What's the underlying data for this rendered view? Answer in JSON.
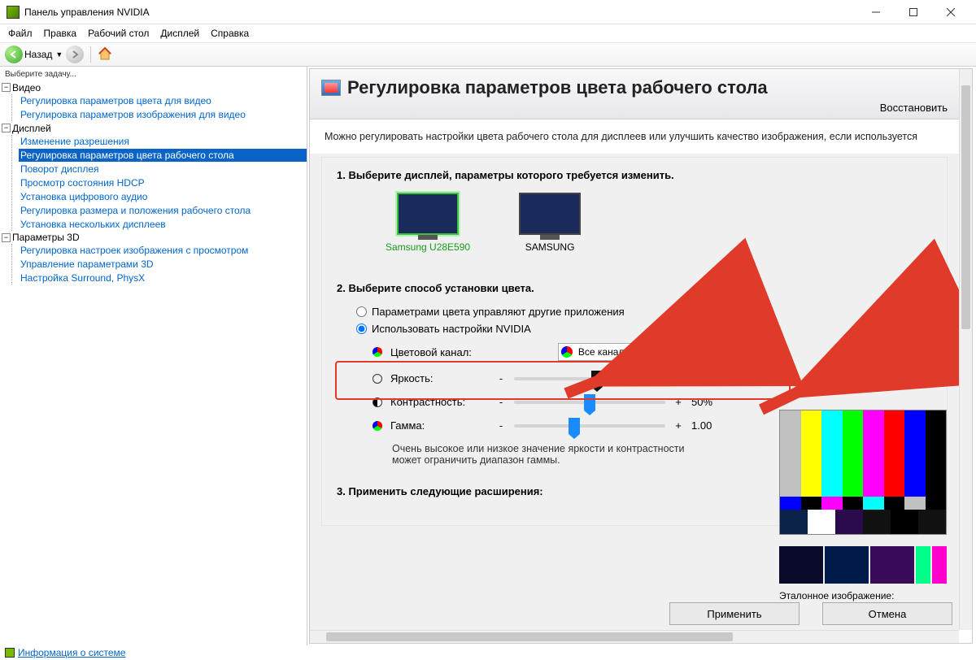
{
  "window": {
    "title": "Панель управления NVIDIA"
  },
  "menu": {
    "file": "Файл",
    "edit": "Правка",
    "desktop": "Рабочий стол",
    "display": "Дисплей",
    "help": "Справка"
  },
  "toolbar": {
    "back": "Назад"
  },
  "sidebar": {
    "task_label": "Выберите задачу...",
    "groups": [
      {
        "label": "Видео",
        "items": [
          "Регулировка параметров цвета для видео",
          "Регулировка параметров изображения для видео"
        ]
      },
      {
        "label": "Дисплей",
        "items": [
          "Изменение разрешения",
          "Регулировка параметров цвета рабочего стола",
          "Поворот дисплея",
          "Просмотр состояния HDCP",
          "Установка цифрового аудио",
          "Регулировка размера и положения рабочего стола",
          "Установка нескольких дисплеев"
        ],
        "selected": 1
      },
      {
        "label": "Параметры 3D",
        "items": [
          "Регулировка настроек изображения с просмотром",
          "Управление параметрами 3D",
          "Настройка Surround, PhysX"
        ]
      }
    ]
  },
  "page": {
    "title": "Регулировка параметров цвета рабочего стола",
    "restore": "Восстановить",
    "intro": "Можно регулировать настройки цвета рабочего стола для дисплеев или улучшить качество изображения, если используется",
    "step1_title": "1. Выберите дисплей, параметры которого требуется изменить.",
    "displays": [
      {
        "name": "Samsung U28E590",
        "active": true
      },
      {
        "name": "SAMSUNG",
        "active": false
      }
    ],
    "step2_title": "2. Выберите способ установки цвета.",
    "radio_other": "Параметрами цвета управляют другие приложения",
    "radio_nvidia": "Использовать настройки NVIDIA",
    "channel_label": "Цветовой канал:",
    "channel_value": "Все каналы",
    "sliders": {
      "brightness": {
        "label": "Яркость:",
        "value": "55%",
        "pos": 55
      },
      "contrast": {
        "label": "Контрастность:",
        "value": "50%",
        "pos": 50
      },
      "gamma": {
        "label": "Гамма:",
        "value": "1.00",
        "pos": 40
      }
    },
    "note": "Очень высокое или низкое значение яркости и контрастности может ограничить диапазон гаммы.",
    "step3_title": "3. Применить следующие расширения:",
    "ref_caption": "Эталонное изображение:"
  },
  "buttons": {
    "apply": "Применить",
    "cancel": "Отмена"
  },
  "status": {
    "info_link": "Информация о системе"
  }
}
